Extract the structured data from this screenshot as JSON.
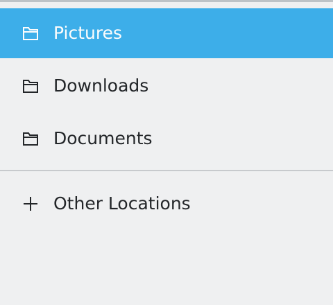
{
  "sidebar": {
    "places": [
      {
        "label": "Pictures",
        "icon": "folder-icon",
        "selected": true
      },
      {
        "label": "Downloads",
        "icon": "folder-icon",
        "selected": false
      },
      {
        "label": "Documents",
        "icon": "folder-icon",
        "selected": false
      }
    ],
    "other": {
      "label": "Other Locations",
      "icon": "plus-icon"
    }
  },
  "colors": {
    "background": "#eff0f1",
    "selection": "#3daee9",
    "selected_text": "#fcfcfc",
    "text": "#232629",
    "divider": "#c7cacd"
  }
}
